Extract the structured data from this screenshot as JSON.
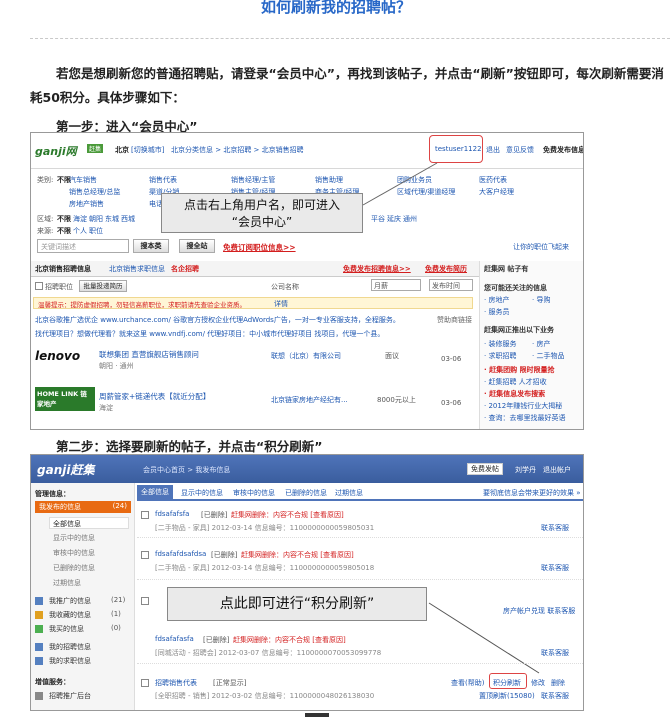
{
  "article": {
    "title": "如何刷新我的招聘帖？",
    "intro": "若您是想刷新您的普通招聘贴，请登录“会员中心”，再找到该帖子，并点击“刷新”按钮即可，每次刷新需要消耗50积分。具体步骤如下：",
    "step1": "第一步：进入“会员中心”",
    "step2": "第二步：选择要刷新的帖子，并点击“积分刷新”"
  },
  "shot1": {
    "logo": "ganji网",
    "logo_badge": "赶集",
    "city": "北京",
    "switch_city": "[切换城市]",
    "breadcrumb": "北京分类信息 > 北京招聘 > 北京销售招聘",
    "username": "testuser1122",
    "top_links": [
      "退出",
      "意见反馈"
    ],
    "top_post": "免费发布信息",
    "filter_label_type": "类别:",
    "filter_label_area": "区域:",
    "filter_label_source": "来源:",
    "not_limited": "不限",
    "type_items": [
      "汽车销售",
      "销售代表",
      "销售经理/主管",
      "销售总经理/总监",
      "销售助理",
      "销售主管/经理",
      "渠道/分销",
      "团购业务员",
      "医药代表",
      "房地产销售",
      "区域代理/渠道经理",
      "大客户经理",
      "电话销售",
      "商务主管/经理",
      "网店销售"
    ],
    "area_items": [
      "海淀",
      "朝阳",
      "东城",
      "西城",
      "丰台",
      "石景山",
      "昌平",
      "平谷",
      "延庆",
      "通州"
    ],
    "source_items": [
      "个人",
      "职位"
    ],
    "search_placeholder": "关键词描述",
    "search_btn": "搜本类",
    "all_btn": "搜全站",
    "subscribe": "免费订阅职位信息>>",
    "right_hint": "让你的职位飞起来",
    "tab_active": "北京销售招聘信息",
    "tab2": "北京销售求职信息",
    "tab3": "名企招聘",
    "post_free": "免费发布招聘信息>>",
    "post_seek": "免费发布简历",
    "checkbox_label": "招聘职位",
    "batch_btn": "批量投递简历",
    "col_company": "公司名称",
    "col_salary": "月薪",
    "col_time": "发布时间",
    "notice": "温馨提示：提防虚假招聘，勿轻信高薪职位，求职前请先查验企业资质。",
    "notice_link": "详情",
    "ad1": "北京谷歌推广选优企 www.urchance.com/ 谷歌官方授权企业代理AdWords广告，一对一专业客服支持，全程服务。",
    "ad1_tag": "赞助商链接",
    "ad2": "找代理项目？想做代理看？就来这里 www.vndfj.com/ 代理好项目：中小城市代理好项目 找项目，代理一个县。",
    "job1_brand": "lenovo",
    "job1_title": "联想集团 直营旗舰店销售顾问",
    "job1_sub": "朝阳 · 通州",
    "job1_company": "联想（北京）有限公司",
    "job1_salary": "面议",
    "job1_date": "03-06",
    "job2_brand": "HOME LINK 链家地产",
    "job2_title": "周薪管家+链递代表【就近分配】",
    "job2_sub": "海淀",
    "job2_company": "北京链家房地产经纪有...",
    "job2_salary": "8000元以上",
    "job2_date": "03-06",
    "side_title": "赶集网 帖子有",
    "side_items": [
      "您可能还关注的信息",
      "· 房地产",
      "· 导购",
      "· 服务员",
      "赶集网正推出以下业务",
      "· 装修服务",
      "· 房产",
      "· 求职招聘",
      "· 二手物品",
      "· 赶集团购 限时限量抢",
      "· 赶集招聘 人才招收",
      "· 赶集信息发布搜索",
      "· 2012年赚钱行业大揭秘",
      "· 查询：去哪里找最好英语"
    ],
    "callout": "点击右上角用户名，即可进入\n“会员中心”"
  },
  "shot2": {
    "logo": "ganji赶集",
    "breadcrumb": "会员中心首页 > 我发布信息",
    "post_btn": "免费发帖",
    "user": "刘学丹",
    "logout": "退出帐户",
    "tabs": [
      "全部信息",
      "显示中的信息",
      "审核中的信息",
      "已删除的信息",
      "过期信息"
    ],
    "tab_hint": "要彻底信息会带来更好的效果 »",
    "sidebar_title": "管理信息：",
    "sidebar_active": "我发布的信息",
    "sidebar_active_count": "(24)",
    "sidebar_sub": [
      "全部信息",
      "显示中的信息",
      "审核中的信息",
      "已删除的信息",
      "过期信息"
    ],
    "sidebar_more": [
      {
        "label": "我推广的信息",
        "count": "(21)"
      },
      {
        "label": "我收藏的信息",
        "count": "(1)"
      },
      {
        "label": "我买的信息",
        "count": "(0)"
      }
    ],
    "sidebar_more2": [
      "我的招聘信息",
      "我的求职信息"
    ],
    "sidebar_title2": "增值服务：",
    "sidebar_promo": "招聘推广后台",
    "posts": [
      {
        "title": "fdsafafsfa",
        "status": "[已删除]",
        "reason": "赶集网删除：内容不合规 [查看原因]",
        "meta": "[二手物品 - 家具] 2012-03-14 信息编号：1100000000059805031",
        "action": "联系客服"
      },
      {
        "title": "fdsafafdsafdsa",
        "status": "[已删除]",
        "reason": "赶集网删除：内容不合规 [查看原因]",
        "meta": "[二手物品 - 家具] 2012-03-14 信息编号：1100000000059805018",
        "action": "联系客服"
      },
      {
        "title": "fdsafafasfa",
        "status": "[已删除]",
        "reason": "赶集网删除：内容不合规 [查看原因]",
        "meta": "[同城活动 - 招聘会] 2012-03-07 信息编号：1100000070053099778",
        "action": "联系客服"
      },
      {
        "title": "招聘销售代表",
        "status": "[正常显示]",
        "reason": "",
        "meta": "[全职招聘 - 销售] 2012-03-02 信息编号：1100000048026138030",
        "action": "联系客服"
      }
    ],
    "right_promo": "房产帐户兑现 联系客服",
    "actions": [
      "查看(帮助)",
      "积分刷新",
      "修改",
      "删除"
    ],
    "refresh_count": "置顶刷新(15080)",
    "callout": "点此即可进行“积分刷新”"
  }
}
